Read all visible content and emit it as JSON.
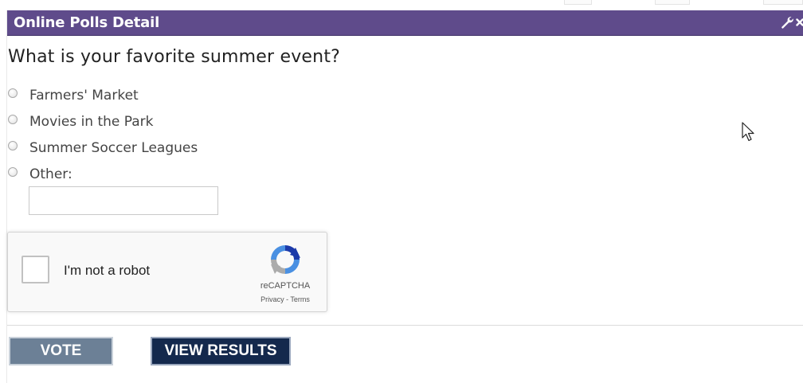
{
  "widget": {
    "title": "Online Polls Detail",
    "tools": [
      {
        "icon": "wrench-icon",
        "symbol": "🔧"
      },
      {
        "icon": "close-icon",
        "symbol": "×"
      }
    ],
    "header_color": "#5f4b8b"
  },
  "poll": {
    "question": "What is your favorite summer event?",
    "options": [
      {
        "label": "Farmers' Market",
        "selected": false
      },
      {
        "label": "Movies in the Park",
        "selected": false
      },
      {
        "label": "Summer Soccer Leagues",
        "selected": false
      },
      {
        "label": "Other:",
        "selected": false
      }
    ],
    "other_input_value": ""
  },
  "captcha": {
    "label": "I'm not a robot",
    "brand": "reCAPTCHA",
    "links": "Privacy - Terms",
    "checked": false
  },
  "actions": {
    "vote_label": "VOTE",
    "results_label": "VIEW RESULTS"
  }
}
